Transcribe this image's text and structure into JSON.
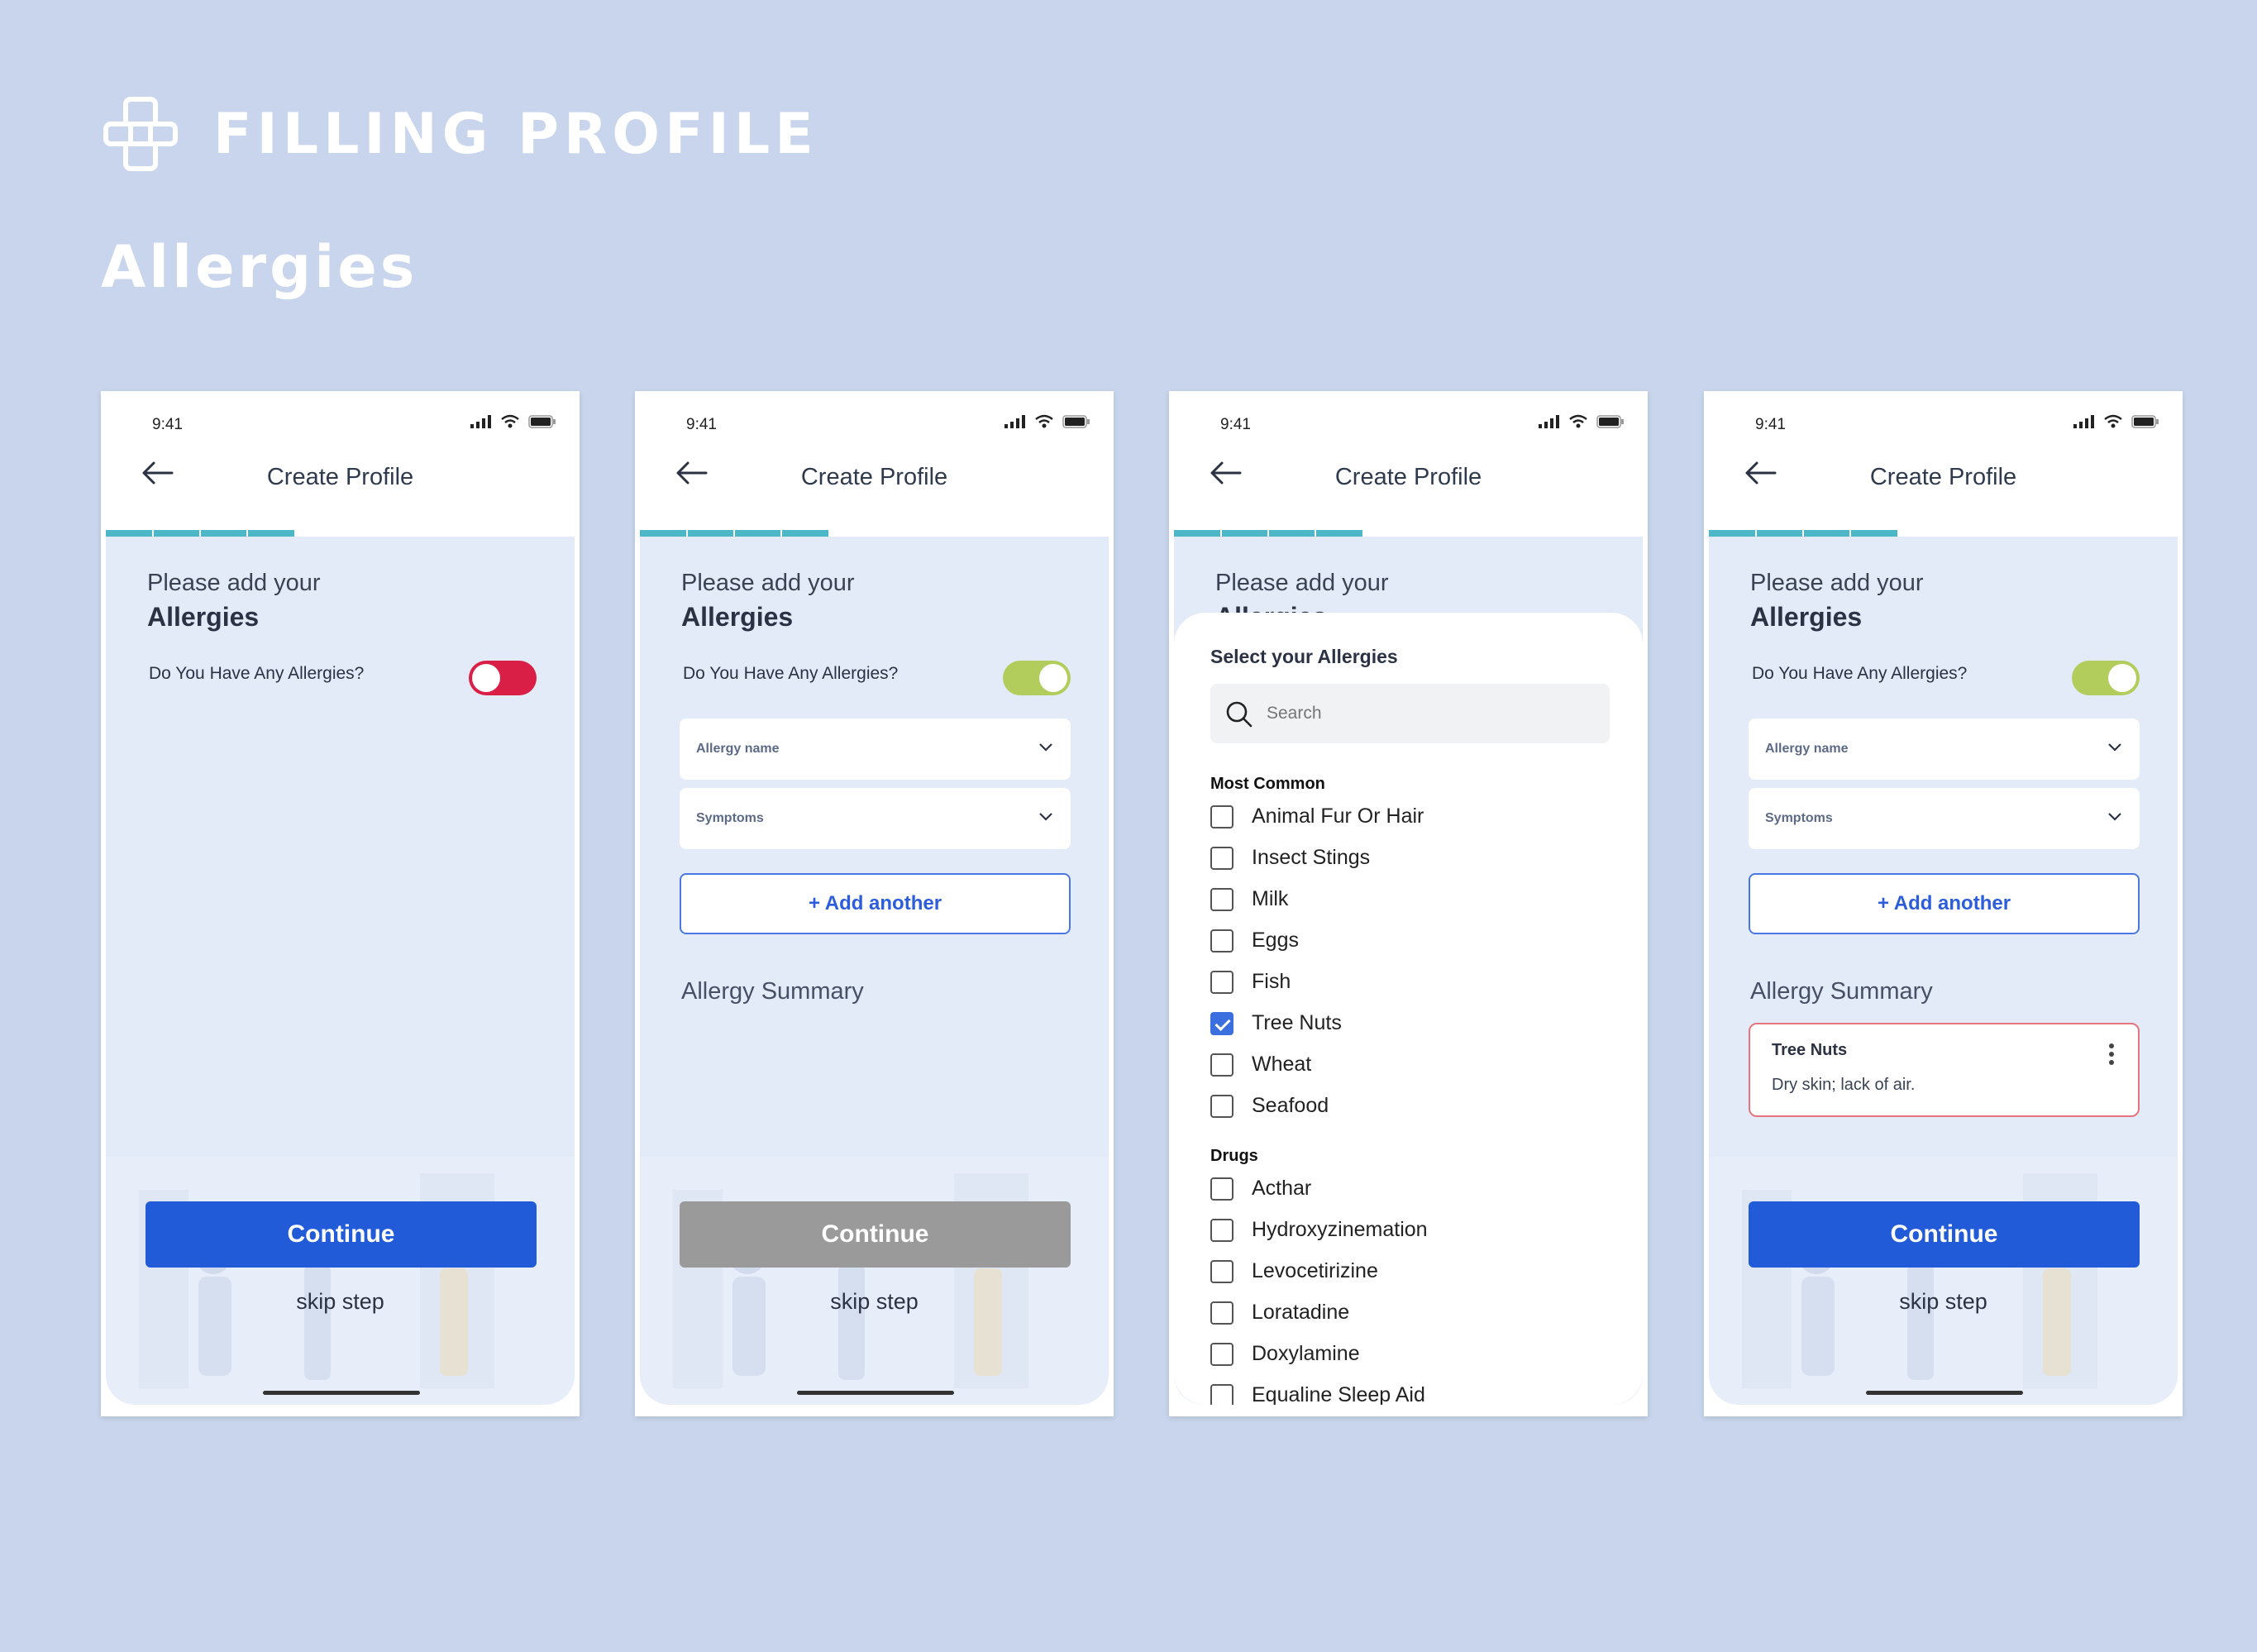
{
  "page": {
    "title": "FILLING PROFILE",
    "section": "Allergies"
  },
  "screens": [
    {
      "time": "9:41",
      "nav_title": "Create Profile",
      "prompt_line1": "Please add your",
      "prompt_line2": "Allergies",
      "question": "Do You Have Any Allergies?",
      "toggle_state": "off",
      "continue_label": "Continue",
      "skip_label": "skip step"
    },
    {
      "time": "9:41",
      "nav_title": "Create Profile",
      "prompt_line1": "Please add your",
      "prompt_line2": "Allergies",
      "question": "Do You Have Any Allergies?",
      "toggle_state": "on",
      "allergy_name_placeholder": "Allergy name",
      "symptoms_placeholder": "Symptoms",
      "add_another_label": "+ Add another",
      "summary_title": "Allergy Summary",
      "continue_label": "Continue",
      "skip_label": "skip step"
    },
    {
      "time": "9:41",
      "nav_title": "Create Profile",
      "prompt_line1": "Please add your",
      "prompt_line2": "Allergies",
      "sheet": {
        "title": "Select your Allergies",
        "search_placeholder": "Search",
        "group_common": "Most Common",
        "common_items": [
          "Animal Fur Or Hair",
          "Insect Stings",
          "Milk",
          "Eggs",
          "Fish",
          "Tree Nuts",
          "Wheat",
          "Seafood"
        ],
        "checked_item": "Tree Nuts",
        "group_drugs": "Drugs",
        "drug_items": [
          "Acthar",
          "Hydroxyzinemation",
          "Levocetirizine",
          "Loratadine",
          "Doxylamine",
          "Equaline Sleep Aid"
        ]
      }
    },
    {
      "time": "9:41",
      "nav_title": "Create Profile",
      "prompt_line1": "Please add your",
      "prompt_line2": "Allergies",
      "question": "Do You Have Any Allergies?",
      "toggle_state": "on",
      "allergy_name_placeholder": "Allergy name",
      "symptoms_placeholder": "Symptoms",
      "add_another_label": "+ Add another",
      "summary_title": "Allergy Summary",
      "summary_card": {
        "name": "Tree Nuts",
        "symptoms": "Dry  skin; lack of air."
      },
      "continue_label": "Continue",
      "skip_label": "skip step"
    }
  ],
  "colors": {
    "background": "#c8d5ec",
    "progress": "#4cb7c6",
    "primary": "#225bd8",
    "disabled": "#9a9a9a",
    "toggle_off": "#d91f46",
    "toggle_on": "#b3cd5c",
    "card_border": "#e4757e"
  },
  "icons": {
    "logo": "medical-cross-icon",
    "back": "back-arrow-icon",
    "chevron": "chevron-down-icon",
    "search": "search-icon",
    "menu": "more-vertical-icon",
    "signal": "signal-icon",
    "wifi": "wifi-icon",
    "battery": "battery-icon"
  }
}
